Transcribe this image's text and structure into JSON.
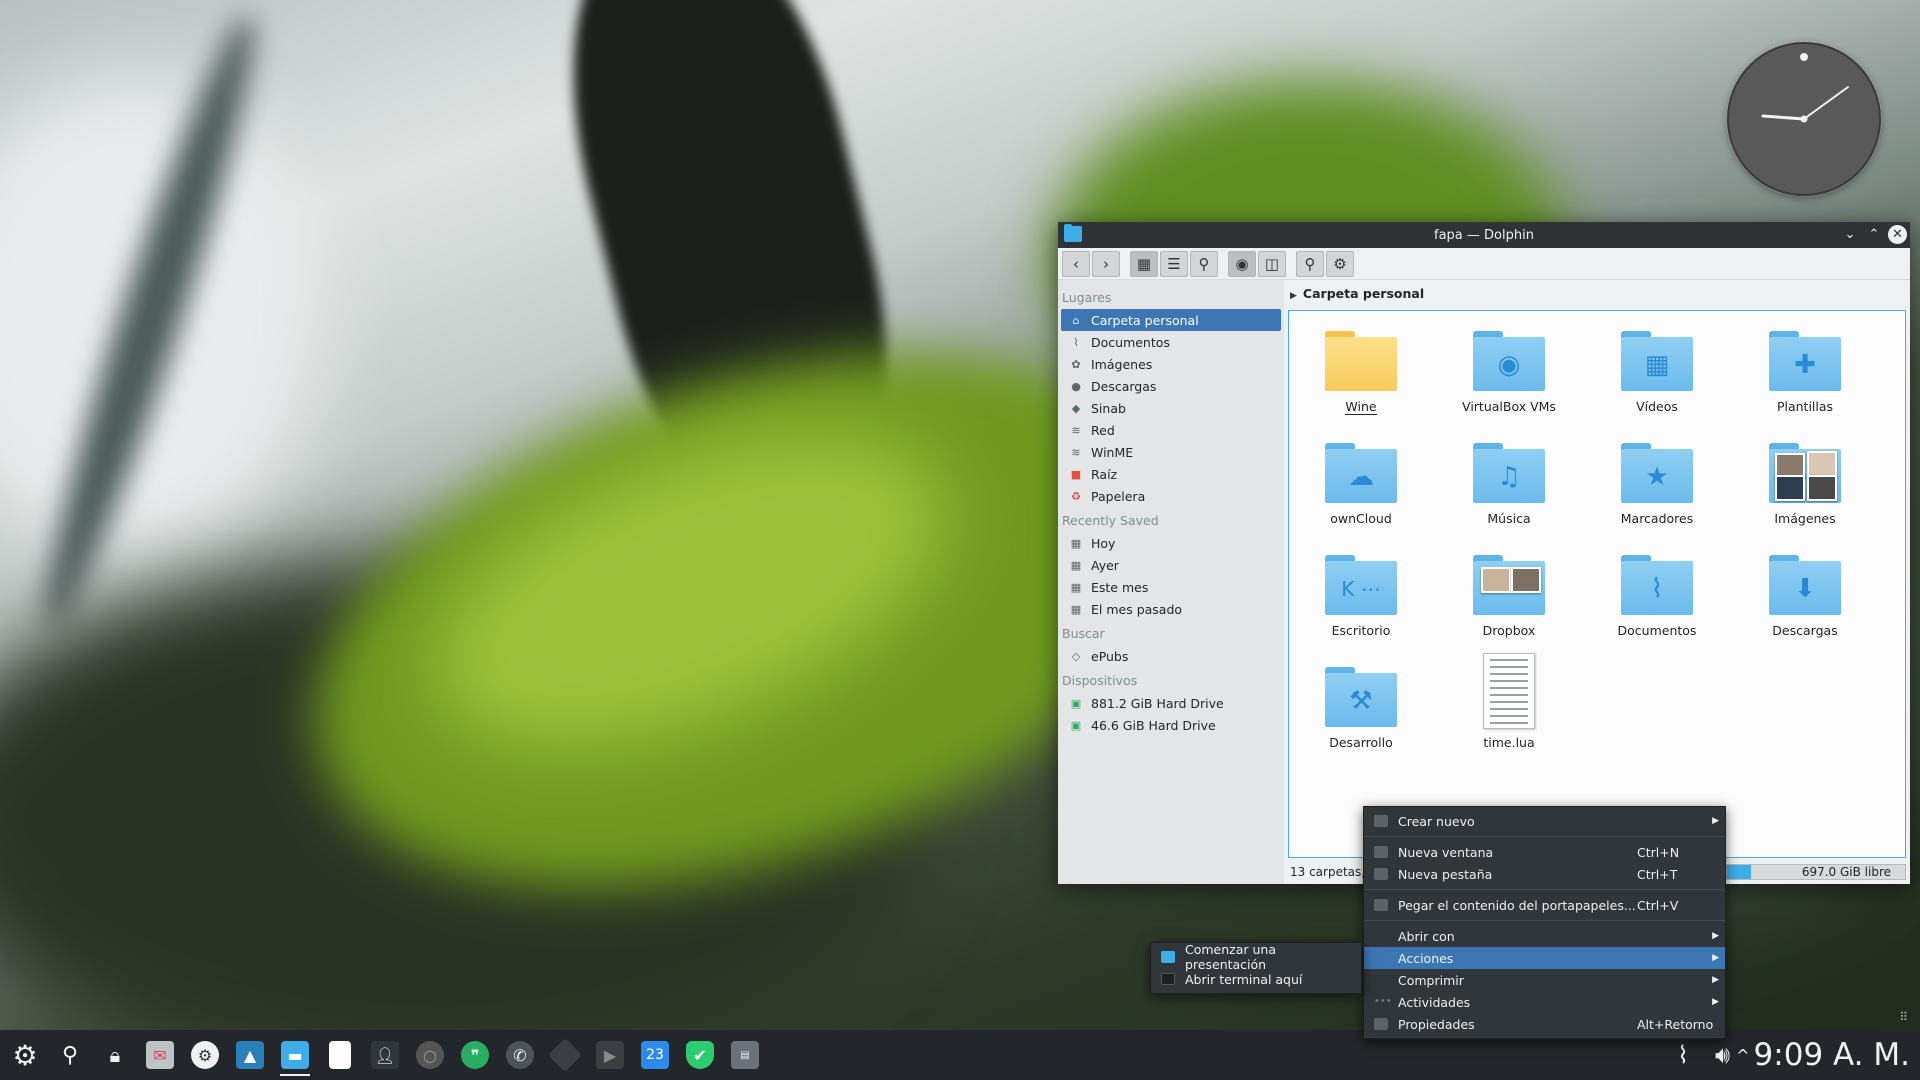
{
  "window": {
    "title": "fapa — Dolphin",
    "breadcrumb": "Carpeta personal"
  },
  "sidebar": {
    "sections": [
      {
        "heading": "Lugares",
        "items": [
          {
            "label": "Carpeta personal",
            "icon": "home-icon",
            "active": true
          },
          {
            "label": "Documentos",
            "icon": "paperclip-icon"
          },
          {
            "label": "Imágenes",
            "icon": "image-icon"
          },
          {
            "label": "Descargas",
            "icon": "download-icon"
          },
          {
            "label": "Sinab",
            "icon": "network-icon"
          },
          {
            "label": "Red",
            "icon": "wifi-icon"
          },
          {
            "label": "WinME",
            "icon": "wifi-icon"
          },
          {
            "label": "Raíz",
            "icon": "red-folder-icon"
          },
          {
            "label": "Papelera",
            "icon": "trash-icon"
          }
        ]
      },
      {
        "heading": "Recently Saved",
        "items": [
          {
            "label": "Hoy",
            "icon": "calendar-icon"
          },
          {
            "label": "Ayer",
            "icon": "calendar-icon"
          },
          {
            "label": "Este mes",
            "icon": "calendar-icon"
          },
          {
            "label": "El mes pasado",
            "icon": "calendar-icon"
          }
        ]
      },
      {
        "heading": "Buscar",
        "items": [
          {
            "label": "ePubs",
            "icon": "search-tag-icon"
          }
        ]
      },
      {
        "heading": "Dispositivos",
        "items": [
          {
            "label": "881.2 GiB Hard Drive",
            "icon": "hard-drive-icon"
          },
          {
            "label": "46.6 GiB Hard Drive",
            "icon": "hard-drive-icon"
          }
        ]
      }
    ]
  },
  "files": [
    {
      "name": "Wine",
      "type": "folder-yellow",
      "glyph": ""
    },
    {
      "name": "VirtualBox VMs",
      "type": "folder",
      "glyph": "◉"
    },
    {
      "name": "Vídeos",
      "type": "folder",
      "glyph": "▦"
    },
    {
      "name": "Plantillas",
      "type": "folder",
      "glyph": "✚"
    },
    {
      "name": "ownCloud",
      "type": "folder",
      "glyph": "☁"
    },
    {
      "name": "Música",
      "type": "folder",
      "glyph": "♫"
    },
    {
      "name": "Marcadores",
      "type": "folder",
      "glyph": "★"
    },
    {
      "name": "Imágenes",
      "type": "photos",
      "glyph": ""
    },
    {
      "name": "Escritorio",
      "type": "folder",
      "glyph": "K ⋯"
    },
    {
      "name": "Dropbox",
      "type": "folder-photos",
      "glyph": ""
    },
    {
      "name": "Documentos",
      "type": "folder",
      "glyph": "⌇"
    },
    {
      "name": "Descargas",
      "type": "folder",
      "glyph": "⬇"
    },
    {
      "name": "Desarrollo",
      "type": "folder",
      "glyph": "⚒"
    },
    {
      "name": "time.lua",
      "type": "text",
      "glyph": ""
    }
  ],
  "status": {
    "summary": "13 carpetas,",
    "free": "697.0 GiB libre"
  },
  "context_menu": {
    "items": [
      {
        "label": "Crear nuevo",
        "shortcut": "",
        "submenu": true,
        "sep_after": true
      },
      {
        "label": "Nueva ventana",
        "shortcut": "Ctrl+N"
      },
      {
        "label": "Nueva pestaña",
        "shortcut": "Ctrl+T",
        "sep_after": true
      },
      {
        "label": "Pegar el contenido del portapapeles...",
        "shortcut": "Ctrl+V",
        "sep_after": true
      },
      {
        "label": "Abrir con",
        "shortcut": "",
        "submenu": true
      },
      {
        "label": "Acciones",
        "shortcut": "",
        "submenu": true,
        "highlight": true
      },
      {
        "label": "Comprimir",
        "shortcut": "",
        "submenu": true
      },
      {
        "label": "Actividades",
        "shortcut": "",
        "submenu": true
      },
      {
        "label": "Propiedades",
        "shortcut": "Alt+Retorno"
      }
    ]
  },
  "actions_submenu": {
    "items": [
      {
        "label": "Comenzar una presentación"
      },
      {
        "label": "Abrir terminal aquí"
      }
    ]
  },
  "taskbar": {
    "calendar_day": "23",
    "clock": "9:09 A. M."
  },
  "colors": {
    "selection": "#3c77b4",
    "accent": "#3daee9",
    "menu_bg": "#31363b",
    "taskbar_bg": "#23262a"
  }
}
